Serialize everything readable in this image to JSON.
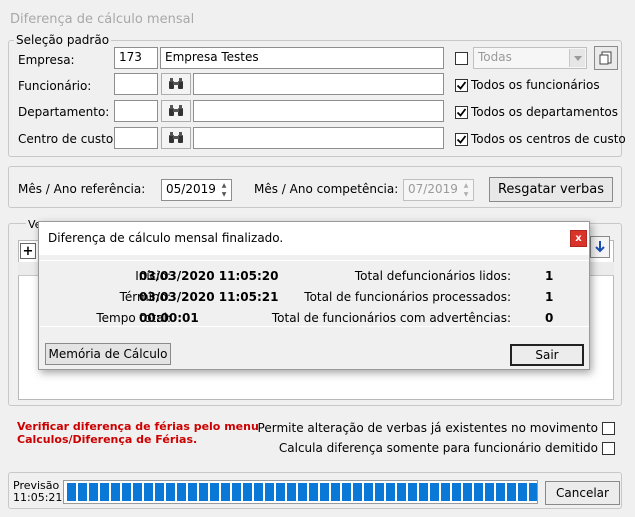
{
  "window": {
    "title": "Diferença de cálculo mensal"
  },
  "selecao": {
    "legend": "Seleção padrão",
    "empresa_label": "Empresa:",
    "empresa_code": "173",
    "empresa_name": "Empresa Testes",
    "todas_label": "Todas",
    "funcionario_label": "Funcionário:",
    "departamento_label": "Departamento:",
    "centro_label": "Centro de custo:",
    "todos_funcionarios": "Todos os funcionários",
    "todos_departamentos": "Todos os departamentos",
    "todos_centros": "Todos os centros de custo"
  },
  "periodo": {
    "mes_ref_label": "Mês / Ano referência:",
    "mes_ref_value": "05/2019",
    "mes_comp_label": "Mês / Ano competência:",
    "mes_comp_value": "07/2019",
    "resgatar_label": "Resgatar verbas"
  },
  "verbas": {
    "legend_partial": "Ve"
  },
  "dialog": {
    "title": "Diferença de cálculo mensal finalizado.",
    "close_glyph": "x",
    "inicio_label": "Início:",
    "inicio_value": "03/03/2020 11:05:20",
    "termino_label": "Término:",
    "termino_value": "03/03/2020 11:05:21",
    "tempo_label": "Tempo total:",
    "tempo_value": "00:00:01",
    "lidos_label": "Total defuncionários lidos:",
    "lidos_value": "1",
    "processados_label": "Total de funcionários processados:",
    "processados_value": "1",
    "advertencias_label": "Total de funcionários com advertências:",
    "advertencias_value": "0",
    "memoria_label": "Memória de Cálculo",
    "sair_label": "Sair"
  },
  "footer": {
    "warning_line1": "Verificar diferença de férias pelo menu",
    "warning_line2": "Calculos/Diferença de Férias.",
    "permite_label": "Permite alteração de verbas já existentes no movimento",
    "calcula_label": "Calcula diferença somente para funcionário demitido",
    "previsao_label": "Previsão",
    "previsao_time": "11:05:21",
    "progress": 1.0,
    "cancelar_label": "Cancelar"
  },
  "colors": {
    "accent": "#0a78d7",
    "warning": "#cc0000",
    "close_button": "#d9332a"
  }
}
